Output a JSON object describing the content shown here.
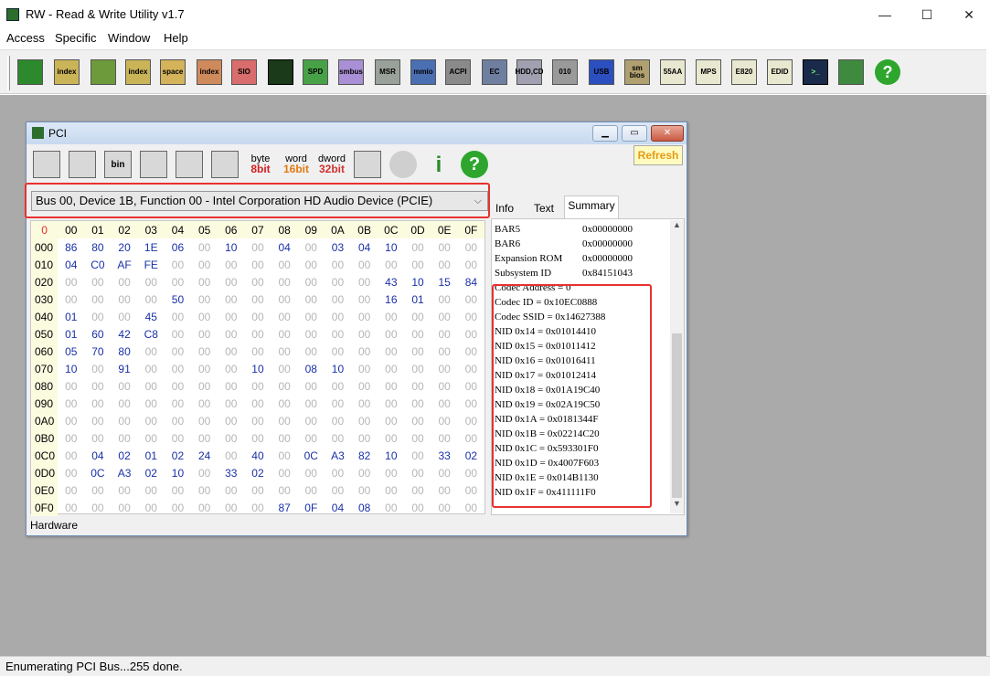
{
  "window": {
    "title": "RW - Read & Write Utility v1.7",
    "minimize": "—",
    "maximize": "☐",
    "close": "✕"
  },
  "menu": [
    "Access",
    "Specific",
    "Window",
    "Help"
  ],
  "toolbar": [
    {
      "icon": "pci-card-icon",
      "label": ""
    },
    {
      "icon": "pci-index-icon",
      "label": "index"
    },
    {
      "icon": "memory-icon",
      "label": ""
    },
    {
      "icon": "memory-index-icon",
      "label": "index"
    },
    {
      "icon": "io-space-icon",
      "label": "space"
    },
    {
      "icon": "io-index-icon",
      "label": "index"
    },
    {
      "icon": "sio-icon",
      "label": "SIO"
    },
    {
      "icon": "oscilloscope-icon",
      "label": ""
    },
    {
      "icon": "spd-icon",
      "label": "SPD"
    },
    {
      "icon": "smbus-icon",
      "label": "smbus"
    },
    {
      "icon": "msr-icon",
      "label": "MSR"
    },
    {
      "icon": "mmio-icon",
      "label": "mmio"
    },
    {
      "icon": "acpi-icon",
      "label": "ACPI"
    },
    {
      "icon": "ec-icon",
      "label": "EC"
    },
    {
      "icon": "hdd-cd-icon",
      "label": "HDD,CD"
    },
    {
      "icon": "binary-icon",
      "label": "010"
    },
    {
      "icon": "usb-icon",
      "label": "USB"
    },
    {
      "icon": "smbios-icon",
      "label": "sm bios"
    },
    {
      "icon": "55aa-icon",
      "label": "55AA"
    },
    {
      "icon": "mps-icon",
      "label": "MPS"
    },
    {
      "icon": "e820-icon",
      "label": "E820"
    },
    {
      "icon": "edid-icon",
      "label": "EDID"
    },
    {
      "icon": "command-prompt-icon",
      "label": ">_"
    },
    {
      "icon": "battery-icon",
      "label": ""
    },
    {
      "icon": "help-icon",
      "label": "?"
    }
  ],
  "pci_window": {
    "title": "PCI",
    "toolbar": [
      {
        "icon": "save-icon",
        "label": ""
      },
      {
        "icon": "save-all-icon",
        "label": ""
      },
      {
        "icon": "save-bin-icon",
        "label": "bin"
      },
      {
        "icon": "load-icon",
        "label": ""
      },
      {
        "icon": "find-binoculars-icon",
        "label": ""
      },
      {
        "icon": "table-view-icon",
        "label": ""
      },
      {
        "icon": "byte-8bit-icon",
        "label": "byte",
        "sub": "8bit"
      },
      {
        "icon": "word-16bit-icon",
        "label": "word",
        "sub": "16bit"
      },
      {
        "icon": "dword-32bit-icon",
        "label": "dword",
        "sub": "32bit"
      },
      {
        "icon": "tree-view-icon",
        "label": ""
      },
      {
        "icon": "disabled-gear-icon",
        "label": ""
      },
      {
        "icon": "info-icon",
        "label": "i"
      },
      {
        "icon": "help-icon",
        "label": "?"
      }
    ],
    "refresh": "Refresh",
    "device": "Bus 00, Device 1B, Function 00 - Intel Corporation HD Audio Device (PCIE)",
    "col_selected": "0",
    "columns": [
      "00",
      "01",
      "02",
      "03",
      "04",
      "05",
      "06",
      "07",
      "08",
      "09",
      "0A",
      "0B",
      "0C",
      "0D",
      "0E",
      "0F"
    ],
    "rows": [
      {
        "addr": "000",
        "cells": [
          "86",
          "80",
          "20",
          "1E",
          "06",
          "00",
          "10",
          "00",
          "04",
          "00",
          "03",
          "04",
          "10",
          "00",
          "00",
          "00"
        ]
      },
      {
        "addr": "010",
        "cells": [
          "04",
          "C0",
          "AF",
          "FE",
          "00",
          "00",
          "00",
          "00",
          "00",
          "00",
          "00",
          "00",
          "00",
          "00",
          "00",
          "00"
        ]
      },
      {
        "addr": "020",
        "cells": [
          "00",
          "00",
          "00",
          "00",
          "00",
          "00",
          "00",
          "00",
          "00",
          "00",
          "00",
          "00",
          "43",
          "10",
          "15",
          "84"
        ]
      },
      {
        "addr": "030",
        "cells": [
          "00",
          "00",
          "00",
          "00",
          "50",
          "00",
          "00",
          "00",
          "00",
          "00",
          "00",
          "00",
          "16",
          "01",
          "00",
          "00"
        ]
      },
      {
        "addr": "040",
        "cells": [
          "01",
          "00",
          "00",
          "45",
          "00",
          "00",
          "00",
          "00",
          "00",
          "00",
          "00",
          "00",
          "00",
          "00",
          "00",
          "00"
        ]
      },
      {
        "addr": "050",
        "cells": [
          "01",
          "60",
          "42",
          "C8",
          "00",
          "00",
          "00",
          "00",
          "00",
          "00",
          "00",
          "00",
          "00",
          "00",
          "00",
          "00"
        ]
      },
      {
        "addr": "060",
        "cells": [
          "05",
          "70",
          "80",
          "00",
          "00",
          "00",
          "00",
          "00",
          "00",
          "00",
          "00",
          "00",
          "00",
          "00",
          "00",
          "00"
        ]
      },
      {
        "addr": "070",
        "cells": [
          "10",
          "00",
          "91",
          "00",
          "00",
          "00",
          "00",
          "10",
          "00",
          "08",
          "10",
          "00",
          "00",
          "00",
          "00",
          "00"
        ]
      },
      {
        "addr": "080",
        "cells": [
          "00",
          "00",
          "00",
          "00",
          "00",
          "00",
          "00",
          "00",
          "00",
          "00",
          "00",
          "00",
          "00",
          "00",
          "00",
          "00"
        ]
      },
      {
        "addr": "090",
        "cells": [
          "00",
          "00",
          "00",
          "00",
          "00",
          "00",
          "00",
          "00",
          "00",
          "00",
          "00",
          "00",
          "00",
          "00",
          "00",
          "00"
        ]
      },
      {
        "addr": "0A0",
        "cells": [
          "00",
          "00",
          "00",
          "00",
          "00",
          "00",
          "00",
          "00",
          "00",
          "00",
          "00",
          "00",
          "00",
          "00",
          "00",
          "00"
        ]
      },
      {
        "addr": "0B0",
        "cells": [
          "00",
          "00",
          "00",
          "00",
          "00",
          "00",
          "00",
          "00",
          "00",
          "00",
          "00",
          "00",
          "00",
          "00",
          "00",
          "00"
        ]
      },
      {
        "addr": "0C0",
        "cells": [
          "00",
          "04",
          "02",
          "01",
          "02",
          "24",
          "00",
          "40",
          "00",
          "0C",
          "A3",
          "82",
          "10",
          "00",
          "33",
          "02"
        ]
      },
      {
        "addr": "0D0",
        "cells": [
          "00",
          "0C",
          "A3",
          "02",
          "10",
          "00",
          "33",
          "02",
          "00",
          "00",
          "00",
          "00",
          "00",
          "00",
          "00",
          "00"
        ]
      },
      {
        "addr": "0E0",
        "cells": [
          "00",
          "00",
          "00",
          "00",
          "00",
          "00",
          "00",
          "00",
          "00",
          "00",
          "00",
          "00",
          "00",
          "00",
          "00",
          "00"
        ]
      },
      {
        "addr": "0F0",
        "cells": [
          "00",
          "00",
          "00",
          "00",
          "00",
          "00",
          "00",
          "00",
          "87",
          "0F",
          "04",
          "08",
          "00",
          "00",
          "00",
          "00"
        ]
      }
    ],
    "tabs": [
      "Info",
      "Text",
      "Summary"
    ],
    "active_tab": "Summary",
    "summary": [
      {
        "k": "BAR5",
        "v": "0x00000000"
      },
      {
        "k": "BAR6",
        "v": "0x00000000"
      },
      {
        "k": "Expansion ROM",
        "v": "0x00000000"
      },
      {
        "k": "Subsystem ID",
        "v": "0x84151043"
      },
      {
        "k": "Codec Address = 0",
        "v": ""
      },
      {
        "k": "Codec ID = 0x10EC0888",
        "v": ""
      },
      {
        "k": "Codec SSID = 0x14627388",
        "v": ""
      },
      {
        "k": "NID 0x14 = 0x01014410",
        "v": ""
      },
      {
        "k": "NID 0x15 = 0x01011412",
        "v": ""
      },
      {
        "k": "NID 0x16 = 0x01016411",
        "v": ""
      },
      {
        "k": "NID 0x17 = 0x01012414",
        "v": ""
      },
      {
        "k": "NID 0x18 = 0x01A19C40",
        "v": ""
      },
      {
        "k": "NID 0x19 = 0x02A19C50",
        "v": ""
      },
      {
        "k": "NID 0x1A = 0x0181344F",
        "v": ""
      },
      {
        "k": "NID 0x1B = 0x02214C20",
        "v": ""
      },
      {
        "k": "NID 0x1C = 0x593301F0",
        "v": ""
      },
      {
        "k": "NID 0x1D = 0x4007F603",
        "v": ""
      },
      {
        "k": "NID 0x1E = 0x014B1130",
        "v": ""
      },
      {
        "k": "NID 0x1F = 0x411111F0",
        "v": ""
      }
    ],
    "footer": "Hardware"
  },
  "status": "Enumerating PCI Bus...255 done.",
  "colors": {
    "highlight": "#e8312e",
    "nonzero": "#1a30a8",
    "zero": "#b6b6b6",
    "refresh": "#e49b18"
  }
}
